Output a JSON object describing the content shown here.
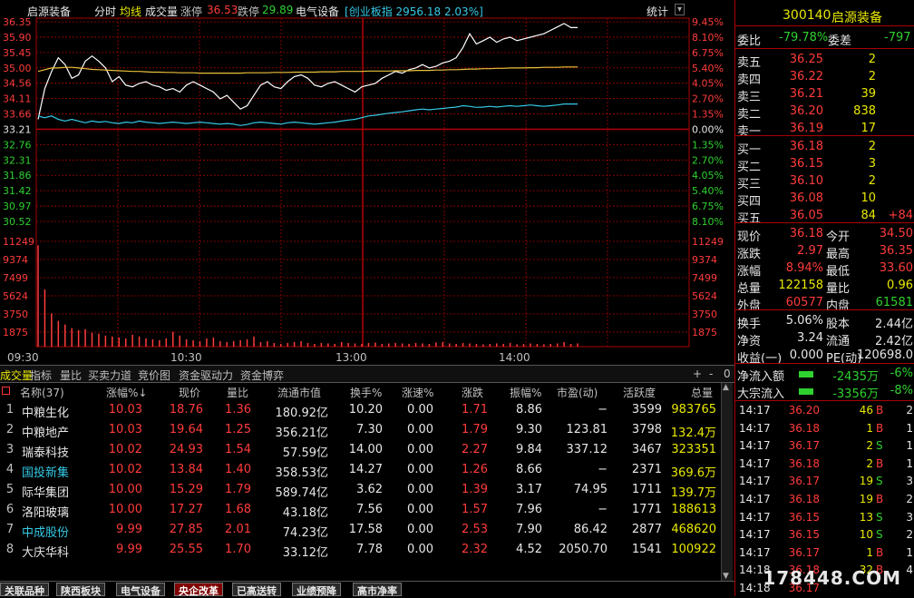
{
  "header": {
    "name": "启源装备",
    "fenshi": "分时",
    "avg_line": "均线",
    "vol_label": "成交量",
    "limit_up_label": "涨停",
    "limit_up": "36.53",
    "limit_down_label": "跌停",
    "limit_down": "29.89",
    "sector": "电气设备",
    "index_tag": "创业板指",
    "index_value": "2956.18 2.03%",
    "stats": "统计"
  },
  "price_axis_left": [
    "36.35",
    "35.90",
    "35.45",
    "35.00",
    "34.56",
    "34.11",
    "33.66",
    "33.21",
    "32.76",
    "32.31",
    "31.86",
    "31.42",
    "30.97",
    "30.52"
  ],
  "price_axis_right": [
    "9.45%",
    "8.10%",
    "6.75%",
    "5.40%",
    "4.05%",
    "2.70%",
    "1.35%",
    "0.00%",
    "1.35%",
    "2.70%",
    "4.05%",
    "5.40%",
    "6.75%",
    "8.10%"
  ],
  "volume_axis": [
    "11249",
    "9374",
    "7499",
    "5624",
    "3750",
    "1875"
  ],
  "time_axis": [
    "09:30",
    "10:30",
    "13:00",
    "14:00"
  ],
  "chart_data": {
    "type": "line",
    "title": "",
    "xlabel": "",
    "ylabel": "",
    "ylim": [
      30.52,
      36.35
    ],
    "base_price": 33.21,
    "series": [
      {
        "name": "",
        "color": "#ffffff",
        "values": [
          33.5,
          34.4,
          34.9,
          35.3,
          35.1,
          34.7,
          34.8,
          35.2,
          35.35,
          35.2,
          35.0,
          34.6,
          34.75,
          34.5,
          34.45,
          34.55,
          34.6,
          34.5,
          34.45,
          34.35,
          34.4,
          34.3,
          34.5,
          34.6,
          34.5,
          34.4,
          34.3,
          34.1,
          34.2,
          34.0,
          33.8,
          33.9,
          34.2,
          34.5,
          34.6,
          34.45,
          34.4,
          34.6,
          34.75,
          34.8,
          34.7,
          34.5,
          34.45,
          34.55,
          34.6,
          34.5,
          34.4,
          34.3,
          34.45,
          34.5,
          34.55,
          34.7,
          34.8,
          34.9,
          34.85,
          34.95,
          35.0,
          35.1,
          35.0,
          35.05,
          35.15,
          35.2,
          35.3,
          35.6,
          36.0,
          35.7,
          35.8,
          35.9,
          35.75,
          35.85,
          35.9,
          35.8,
          35.85,
          35.9,
          35.95,
          36.0,
          36.1,
          36.2,
          36.3,
          36.18,
          36.18
        ]
      },
      {
        "name": "",
        "color": "#e8c13a",
        "values": [
          34.9,
          34.95,
          35.0,
          35.0,
          35.02,
          35.02,
          35.0,
          34.98,
          34.96,
          34.95,
          34.94,
          34.93,
          34.92,
          34.91,
          34.9,
          34.9,
          34.89,
          34.88,
          34.88,
          34.87,
          34.87,
          34.86,
          34.86,
          34.86,
          34.85,
          34.85,
          34.85,
          34.85,
          34.85,
          34.85,
          34.85,
          34.86,
          34.86,
          34.86,
          34.86,
          34.87,
          34.87,
          34.87,
          34.88,
          34.88,
          34.88,
          34.88,
          34.89,
          34.89,
          34.89,
          34.9,
          34.9,
          34.9,
          34.9,
          34.91,
          34.91,
          34.91,
          34.91,
          34.92,
          34.92,
          34.92,
          34.93,
          34.93,
          34.93,
          34.94,
          34.94,
          34.95,
          34.95,
          34.96,
          34.97,
          34.97,
          34.98,
          34.98,
          34.99,
          34.99,
          35.0,
          35.0,
          35.0,
          35.01,
          35.01,
          35.02,
          35.02,
          35.02,
          35.03,
          35.03,
          35.03
        ]
      },
      {
        "name": "",
        "color": "#35c9e5",
        "values": [
          33.6,
          33.55,
          33.6,
          33.5,
          33.45,
          33.5,
          33.45,
          33.4,
          33.45,
          33.42,
          33.44,
          33.4,
          33.38,
          33.42,
          33.4,
          33.45,
          33.42,
          33.4,
          33.38,
          33.4,
          33.42,
          33.4,
          33.38,
          33.4,
          33.42,
          33.4,
          33.38,
          33.36,
          33.38,
          33.36,
          33.32,
          33.35,
          33.4,
          33.42,
          33.4,
          33.38,
          33.36,
          33.4,
          33.42,
          33.4,
          33.38,
          33.36,
          33.38,
          33.4,
          33.42,
          33.45,
          33.48,
          33.5,
          33.55,
          33.6,
          33.62,
          33.65,
          33.68,
          33.7,
          33.72,
          33.75,
          33.78,
          33.8,
          33.78,
          33.8,
          33.82,
          33.84,
          33.86,
          33.9,
          33.88,
          33.85,
          33.86,
          33.88,
          33.86,
          33.88,
          33.9,
          33.88,
          33.9,
          33.92,
          33.9,
          33.88,
          33.9,
          33.92,
          33.95,
          33.95,
          33.95
        ]
      },
      {
        "name": "volume",
        "color": "#ff3b3b",
        "values": [
          11000,
          6200,
          3600,
          2800,
          2400,
          2000,
          1800,
          1900,
          1500,
          1400,
          1200,
          1100,
          1000,
          900,
          1300,
          1100,
          900,
          800,
          700,
          900,
          1600,
          1200,
          800,
          700,
          600,
          900,
          1000,
          600,
          500,
          600,
          700,
          800,
          1100,
          500,
          600,
          400,
          300,
          400,
          500,
          600,
          400,
          300,
          400,
          350,
          300,
          500,
          400,
          350,
          300,
          400,
          450,
          300,
          350,
          400,
          350,
          300,
          400,
          350,
          300,
          450,
          500,
          350,
          300,
          400,
          350,
          300,
          250,
          300,
          350,
          300,
          400,
          250,
          300,
          350,
          300,
          250,
          300,
          350,
          500,
          300,
          350
        ]
      }
    ]
  },
  "tabs": [
    "成交量",
    "指标",
    "量比",
    "买卖力道",
    "竞价图",
    "资金驱动力",
    "资金博弈"
  ],
  "tab_controls": [
    "+",
    "-",
    "0"
  ],
  "table": {
    "headers": [
      "名称(37)",
      "涨幅%↓",
      "现价",
      "量比",
      "流通市值",
      "换手%",
      "涨速%",
      "涨跌",
      "振幅%",
      "市盈(动)",
      "活跃度",
      "总量"
    ],
    "rows": [
      {
        "n": "1",
        "name": "中粮生化",
        "chg": "10.03",
        "price": "18.76",
        "vr": "1.36",
        "mcap": "180.92亿",
        "turn": "10.20",
        "speed": "0.00",
        "diff": "1.71",
        "amp": "8.86",
        "pe": "−",
        "act": "3599",
        "vol": "983765",
        "name_color": "#e6e6e6"
      },
      {
        "n": "2",
        "name": "中粮地产",
        "chg": "10.03",
        "price": "19.64",
        "vr": "1.25",
        "mcap": "356.21亿",
        "turn": "7.30",
        "speed": "0.00",
        "diff": "1.79",
        "amp": "9.30",
        "pe": "123.81",
        "act": "3798",
        "vol": "132.4万",
        "name_color": "#e6e6e6"
      },
      {
        "n": "3",
        "name": "瑞泰科技",
        "chg": "10.02",
        "price": "24.93",
        "vr": "1.54",
        "mcap": "57.59亿",
        "turn": "14.00",
        "speed": "0.00",
        "diff": "2.27",
        "amp": "9.84",
        "pe": "337.12",
        "act": "3467",
        "vol": "323351",
        "name_color": "#e6e6e6"
      },
      {
        "n": "4",
        "name": "国投新集",
        "chg": "10.02",
        "price": "13.84",
        "vr": "1.40",
        "mcap": "358.53亿",
        "turn": "14.27",
        "speed": "0.00",
        "diff": "1.26",
        "amp": "8.66",
        "pe": "−",
        "act": "2371",
        "vol": "369.6万",
        "name_color": "#35c9e5"
      },
      {
        "n": "5",
        "name": "际华集团",
        "chg": "10.00",
        "price": "15.29",
        "vr": "1.79",
        "mcap": "589.74亿",
        "turn": "3.62",
        "speed": "0.00",
        "diff": "1.39",
        "amp": "3.17",
        "pe": "74.95",
        "act": "1711",
        "vol": "139.7万",
        "name_color": "#e6e6e6"
      },
      {
        "n": "6",
        "name": "洛阳玻璃",
        "chg": "10.00",
        "price": "17.27",
        "vr": "1.68",
        "mcap": "43.18亿",
        "turn": "7.56",
        "speed": "0.00",
        "diff": "1.57",
        "amp": "7.96",
        "pe": "−",
        "act": "1771",
        "vol": "188613",
        "name_color": "#e6e6e6"
      },
      {
        "n": "7",
        "name": "中成股份",
        "chg": "9.99",
        "price": "27.85",
        "vr": "2.01",
        "mcap": "74.23亿",
        "turn": "17.58",
        "speed": "0.00",
        "diff": "2.53",
        "amp": "7.90",
        "pe": "86.42",
        "act": "2877",
        "vol": "468620",
        "name_color": "#35c9e5"
      },
      {
        "n": "8",
        "name": "大庆华科",
        "chg": "9.99",
        "price": "25.55",
        "vr": "1.70",
        "mcap": "33.12亿",
        "turn": "7.78",
        "speed": "0.00",
        "diff": "2.32",
        "amp": "4.52",
        "pe": "2050.70",
        "act": "1541",
        "vol": "100922",
        "name_color": "#e6e6e6"
      }
    ]
  },
  "bottom_tabs": [
    "关联品种",
    "陕西板块",
    "电气设备",
    "央企改革",
    "已高送转",
    "业绩预降",
    "高市净率"
  ],
  "side": {
    "code": "300140",
    "name": "启源装备",
    "weibi_label": "委比",
    "weibi": "-79.78%",
    "weicha_label": "委差",
    "weicha": "-797",
    "asks": [
      {
        "label": "卖五",
        "price": "36.25",
        "qty": "2"
      },
      {
        "label": "卖四",
        "price": "36.22",
        "qty": "2"
      },
      {
        "label": "卖三",
        "price": "36.21",
        "qty": "39"
      },
      {
        "label": "卖二",
        "price": "36.20",
        "qty": "838"
      },
      {
        "label": "卖一",
        "price": "36.19",
        "qty": "17"
      }
    ],
    "bids": [
      {
        "label": "买一",
        "price": "36.18",
        "qty": "2",
        "extra": ""
      },
      {
        "label": "买二",
        "price": "36.15",
        "qty": "3",
        "extra": ""
      },
      {
        "label": "买三",
        "price": "36.10",
        "qty": "2",
        "extra": ""
      },
      {
        "label": "买四",
        "price": "36.08",
        "qty": "10",
        "extra": ""
      },
      {
        "label": "买五",
        "price": "36.05",
        "qty": "84",
        "extra": "+84"
      }
    ],
    "quote": [
      {
        "l1": "现价",
        "v1": "36.18",
        "c1": "#ff3b3b",
        "l2": "今开",
        "v2": "34.50",
        "c2": "#ff3b3b"
      },
      {
        "l1": "涨跌",
        "v1": "2.97",
        "c1": "#ff3b3b",
        "l2": "最高",
        "v2": "36.35",
        "c2": "#ff3b3b"
      },
      {
        "l1": "涨幅",
        "v1": "8.94%",
        "c1": "#ff3b3b",
        "l2": "最低",
        "v2": "33.60",
        "c2": "#ff3b3b"
      },
      {
        "l1": "总量",
        "v1": "122158",
        "c1": "#e8e800",
        "l2": "量比",
        "v2": "0.96",
        "c2": "#e8e800"
      },
      {
        "l1": "外盘",
        "v1": "60577",
        "c1": "#ff3b3b",
        "l2": "内盘",
        "v2": "61581",
        "c2": "#2fd12f"
      }
    ],
    "quote2": [
      {
        "l1": "换手",
        "v1": "5.06%",
        "c1": "#e6e6e6",
        "l2": "股本",
        "v2": "2.44亿",
        "c2": "#e6e6e6"
      },
      {
        "l1": "净资",
        "v1": "3.24",
        "c1": "#e6e6e6",
        "l2": "流通",
        "v2": "2.42亿",
        "c2": "#e6e6e6"
      },
      {
        "l1": "收益(一)",
        "v1": "0.000",
        "c1": "#e6e6e6",
        "l2": "PE(动)",
        "v2": "120698.0",
        "c2": "#e6e6e6"
      }
    ],
    "flow": [
      {
        "label": "净流入额",
        "value": "-2435万",
        "pct": "-6%"
      },
      {
        "label": "大宗流入",
        "value": "-3356万",
        "pct": "-8%"
      }
    ],
    "ticks": [
      {
        "t": "14:17",
        "p": "36.20",
        "v": "46",
        "bs": "B",
        "c": "2"
      },
      {
        "t": "14:17",
        "p": "36.18",
        "v": "1",
        "bs": "B",
        "c": "1"
      },
      {
        "t": "14:17",
        "p": "36.17",
        "v": "2",
        "bs": "S",
        "c": "1"
      },
      {
        "t": "14:17",
        "p": "36.18",
        "v": "2",
        "bs": "B",
        "c": "1"
      },
      {
        "t": "14:17",
        "p": "36.17",
        "v": "19",
        "bs": "S",
        "c": "3"
      },
      {
        "t": "14:17",
        "p": "36.18",
        "v": "19",
        "bs": "B",
        "c": "2"
      },
      {
        "t": "14:17",
        "p": "36.15",
        "v": "13",
        "bs": "S",
        "c": "3"
      },
      {
        "t": "14:17",
        "p": "36.15",
        "v": "10",
        "bs": "S",
        "c": "2"
      },
      {
        "t": "14:17",
        "p": "36.17",
        "v": "1",
        "bs": "B",
        "c": "1"
      },
      {
        "t": "14:18",
        "p": "36.18",
        "v": "32",
        "bs": "B",
        "c": "4"
      },
      {
        "t": "14:18",
        "p": "36.17",
        "v": "",
        "bs": "",
        "c": ""
      }
    ],
    "watermark": "178448.COM"
  }
}
